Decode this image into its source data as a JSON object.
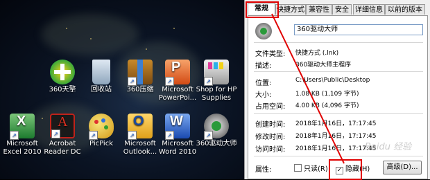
{
  "desktop": {
    "icons": [
      {
        "name": "360-defender-icon",
        "label": "360天擎",
        "label2": ""
      },
      {
        "name": "recycle-bin-icon",
        "label": "回收站",
        "label2": ""
      },
      {
        "name": "360-zip-icon",
        "label": "360压缩",
        "label2": ""
      },
      {
        "name": "powerpoint-icon",
        "label": "Microsoft",
        "label2": "PowerPoi..."
      },
      {
        "name": "hp-shop-icon",
        "label": "Shop for HP",
        "label2": "Supplies"
      },
      {
        "name": "excel-icon",
        "label": "Microsoft",
        "label2": "Excel 2010"
      },
      {
        "name": "acrobat-icon",
        "label": "Acrobat",
        "label2": "Reader DC"
      },
      {
        "name": "picpick-icon",
        "label": "PicPick",
        "label2": ""
      },
      {
        "name": "outlook-icon",
        "label": "Microsoft",
        "label2": "Outlook..."
      },
      {
        "name": "word-icon",
        "label": "Microsoft",
        "label2": "Word 2010"
      },
      {
        "name": "360-driver-icon",
        "label": "360驱动大师",
        "label2": ""
      }
    ]
  },
  "dialog": {
    "tabs": [
      "常规",
      "快捷方式",
      "兼容性",
      "安全",
      "详细信息",
      "以前的版本"
    ],
    "file_name": "360驱动大师",
    "fields": [
      {
        "label": "文件类型:",
        "value": "快捷方式 (.lnk)"
      },
      {
        "label": "描述:",
        "value": "360驱动大师主程序"
      },
      {
        "label": "位置:",
        "value": "C:\\Users\\Public\\Desktop"
      },
      {
        "label": "大小:",
        "value": "1.08 KB (1,109 字节)"
      },
      {
        "label": "占用空间:",
        "value": "4.00 KB (4,096 字节)"
      },
      {
        "label": "创建时间:",
        "value": "2018年1月16日，17:17:45"
      },
      {
        "label": "修改时间:",
        "value": "2018年1月16日，17:17:45"
      },
      {
        "label": "访问时间:",
        "value": "2018年1月16日，17:17:45"
      }
    ],
    "attr_label": "属性:",
    "readonly_label": "只读(R)",
    "hidden_label": "隐藏(H)",
    "hidden_checked": "✓",
    "advanced_label": "高级(D)...",
    "watermark": "Baidu 经验"
  },
  "colors": {
    "highlight": "#e00000"
  }
}
